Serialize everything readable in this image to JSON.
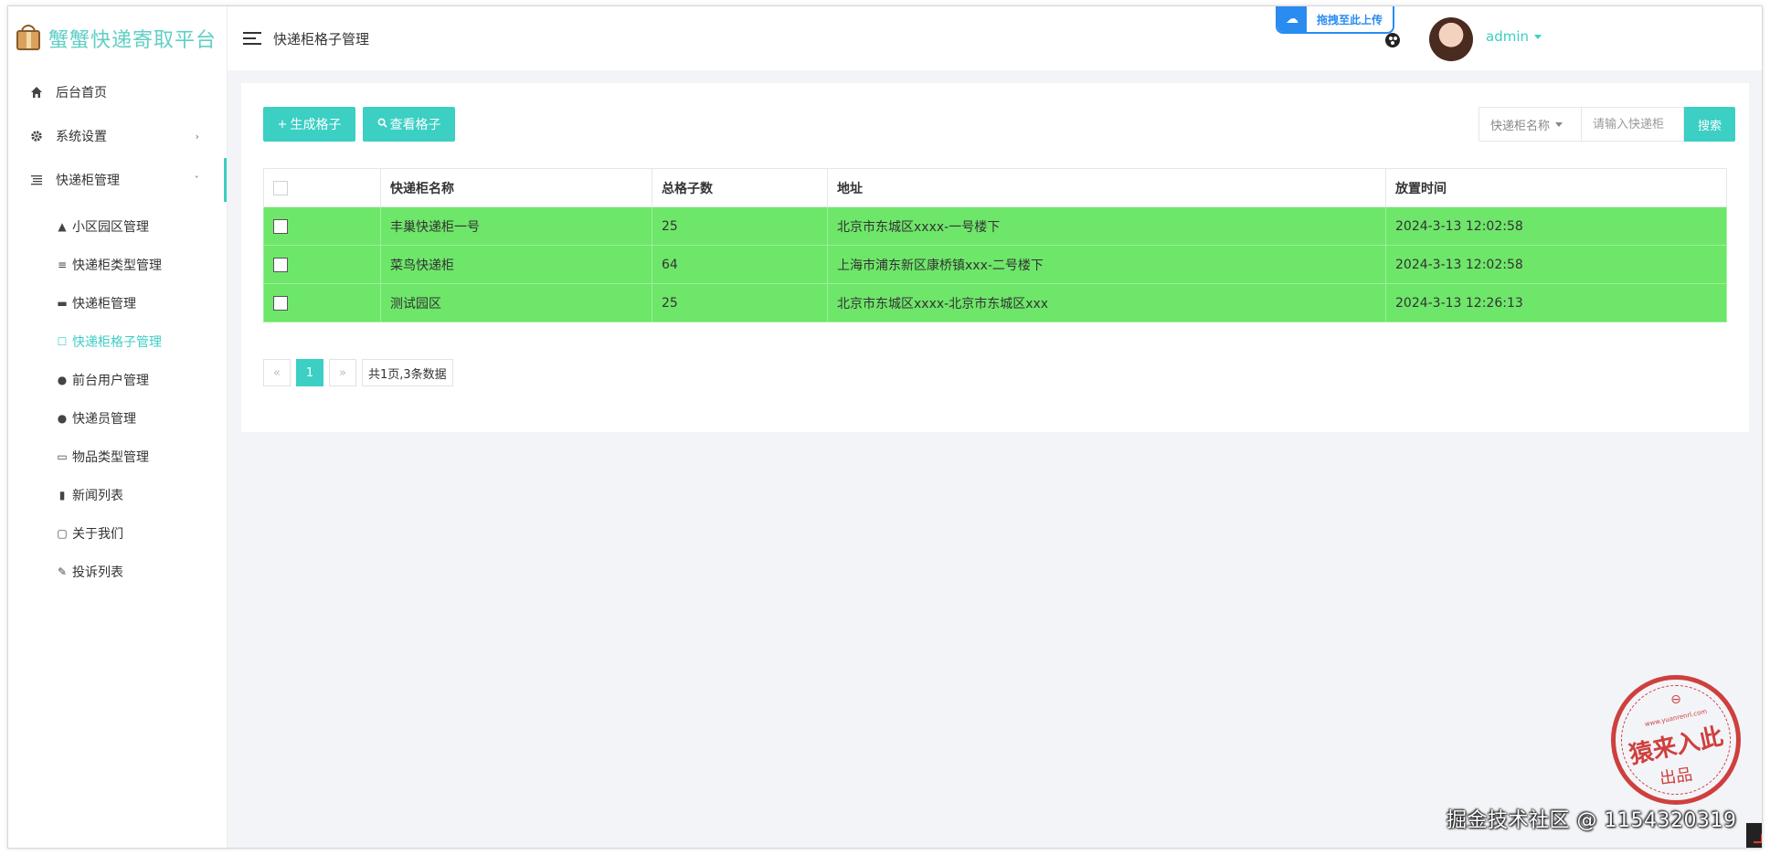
{
  "app": {
    "title": "蟹蟹快递寄取平台"
  },
  "header": {
    "page_title": "快递柜格子管理",
    "upload_badge": "拖拽至此上传",
    "user_name": "admin"
  },
  "sidebar": {
    "items": [
      {
        "label": "后台首页",
        "icon": "home-icon"
      },
      {
        "label": "系统设置",
        "icon": "gear-icon",
        "caret": "›"
      },
      {
        "label": "快递柜管理",
        "icon": "list-icon",
        "caret": "ˇ"
      }
    ],
    "subitems": [
      {
        "label": "小区园区管理",
        "icon": "navigation-icon",
        "glyph": "▲"
      },
      {
        "label": "快递柜类型管理",
        "icon": "menu-icon",
        "glyph": "≡"
      },
      {
        "label": "快递柜管理",
        "icon": "id-card-icon",
        "glyph": "▬"
      },
      {
        "label": "快递柜格子管理",
        "icon": "square-icon",
        "glyph": "☐",
        "active": true
      },
      {
        "label": "前台用户管理",
        "icon": "user-icon",
        "glyph": "●"
      },
      {
        "label": "快递员管理",
        "icon": "user-icon",
        "glyph": "●"
      },
      {
        "label": "物品类型管理",
        "icon": "folder-icon",
        "glyph": "▭"
      },
      {
        "label": "新闻列表",
        "icon": "file-icon",
        "glyph": "▮"
      },
      {
        "label": "关于我们",
        "icon": "comment-icon",
        "glyph": "▢"
      },
      {
        "label": "投诉列表",
        "icon": "pencil-icon",
        "glyph": "✎"
      }
    ]
  },
  "toolbar": {
    "generate_label": "生成格子",
    "view_label": "查看格子",
    "search_field_label": "快递柜名称",
    "search_placeholder": "请输入快递柜",
    "search_button": "搜索"
  },
  "table": {
    "columns": [
      "快递柜名称",
      "总格子数",
      "地址",
      "放置时间"
    ],
    "rows": [
      {
        "name": "丰巢快递柜一号",
        "total": "25",
        "address": "北京市东城区xxxx-一号楼下",
        "time": "2024-3-13 12:02:58"
      },
      {
        "name": "菜鸟快递柜",
        "total": "64",
        "address": "上海市浦东新区康桥镇xxx-二号楼下",
        "time": "2024-3-13 12:02:58"
      },
      {
        "name": "测试园区",
        "total": "25",
        "address": "北京市东城区xxxx-北京市东城区xxx",
        "time": "2024-3-13 12:26:13"
      }
    ]
  },
  "pagination": {
    "prev": "«",
    "current": "1",
    "next": "»",
    "summary": "共1页,3条数据"
  },
  "stamp": {
    "top": "⊖",
    "url": "www.yuanrenrl.com",
    "main": "猿来入此",
    "sub": "出品"
  },
  "watermark": "掘金技术社区 @ 1154320319"
}
